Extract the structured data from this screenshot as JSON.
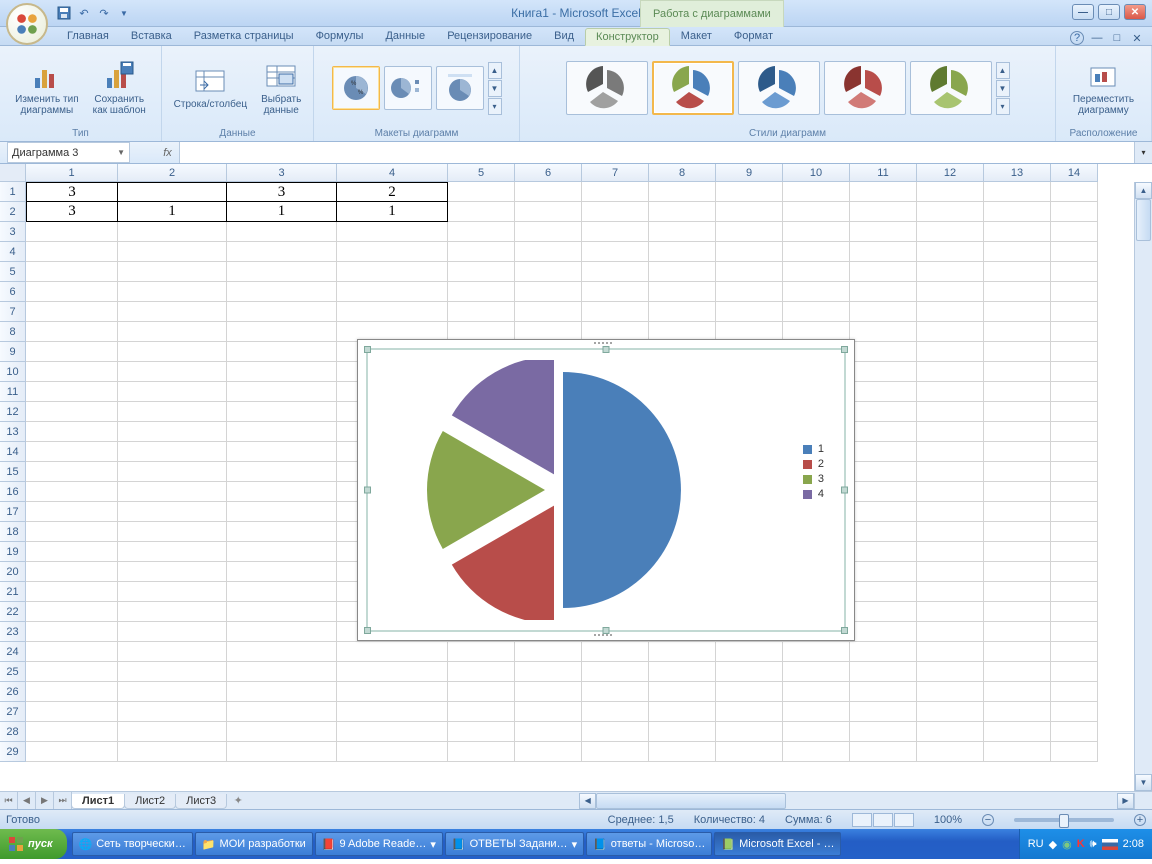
{
  "title": "Книга1 - Microsoft Excel",
  "title_context": "Работа с диаграммами",
  "tabs": {
    "items": [
      "Главная",
      "Вставка",
      "Разметка страницы",
      "Формулы",
      "Данные",
      "Рецензирование",
      "Вид",
      "Конструктор",
      "Макет",
      "Формат"
    ],
    "active_index": 7
  },
  "ribbon": {
    "group_type": "Тип",
    "change_type": "Изменить тип\nдиаграммы",
    "save_template": "Сохранить\nкак шаблон",
    "group_data": "Данные",
    "row_col": "Строка/столбец",
    "select_data": "Выбрать\nданные",
    "group_layouts": "Макеты диаграмм",
    "group_styles": "Стили диаграмм",
    "group_loc": "Расположение",
    "move_chart": "Переместить\nдиаграмму"
  },
  "namebox": "Диаграмма 3",
  "grid": {
    "col_headers": [
      "1",
      "2",
      "3",
      "4",
      "5",
      "6",
      "7",
      "8",
      "9",
      "10",
      "11",
      "12",
      "13",
      "14"
    ],
    "rows": [
      [
        "3",
        "",
        "3",
        "2"
      ],
      [
        "3",
        "1",
        "1",
        "1"
      ]
    ],
    "visible_rows": 29
  },
  "sheet_tabs": [
    "Лист1",
    "Лист2",
    "Лист3"
  ],
  "status": {
    "ready": "Готово",
    "avg_label": "Среднее:",
    "avg": "1,5",
    "count_label": "Количество:",
    "count": "4",
    "sum_label": "Сумма:",
    "sum": "6",
    "zoom": "100%"
  },
  "taskbar": {
    "start": "пуск",
    "items": [
      "Сеть творчески…",
      "МОИ разработки",
      "9 Adobe Reade…",
      "ОТВЕТЫ Задани…",
      "ответы - Microso…",
      "Microsoft Excel - …"
    ],
    "tray_lang": "RU",
    "tray_time": "2:08"
  },
  "chart_data": {
    "type": "pie",
    "categories": [
      "1",
      "2",
      "3",
      "4"
    ],
    "values": [
      3,
      1,
      1,
      1
    ],
    "colors": [
      "#4a7fb9",
      "#b84d4a",
      "#89a64d",
      "#7a6aa3"
    ],
    "exploded": [
      false,
      true,
      true,
      true
    ],
    "title": "",
    "legend_position": "right"
  }
}
